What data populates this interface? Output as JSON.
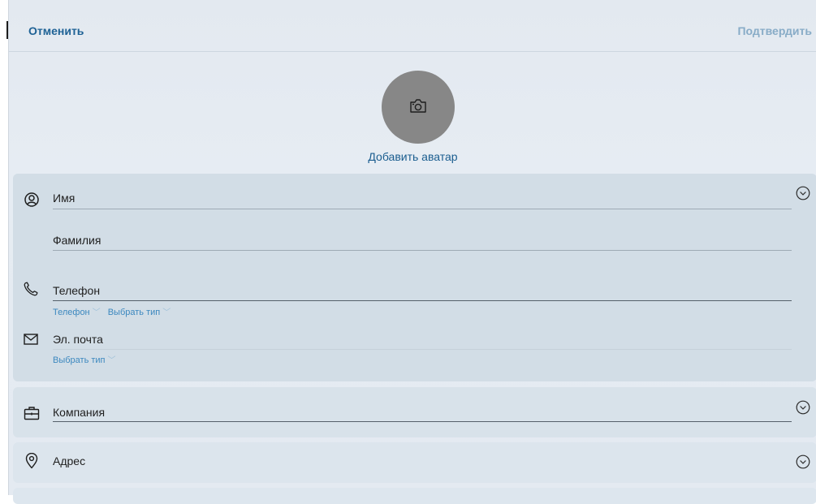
{
  "header": {
    "cancel_label": "Отменить",
    "confirm_label": "Подтвердить"
  },
  "avatar": {
    "add_label": "Добавить аватар",
    "icon": "camera-icon"
  },
  "contact": {
    "first_name_placeholder": "Имя",
    "last_name_placeholder": "Фамилия",
    "phone_placeholder": "Телефон",
    "phone_type_label": "Телефон",
    "phone_select_type_label": "Выбрать тип",
    "email_placeholder": "Эл. почта",
    "email_select_type_label": "Выбрать тип"
  },
  "company": {
    "placeholder": "Компания"
  },
  "address": {
    "label": "Адрес"
  },
  "colors": {
    "accent": "#1e6295",
    "accent_disabled": "#88acc7",
    "link": "#3c88bf",
    "avatar_bg": "#878787"
  }
}
